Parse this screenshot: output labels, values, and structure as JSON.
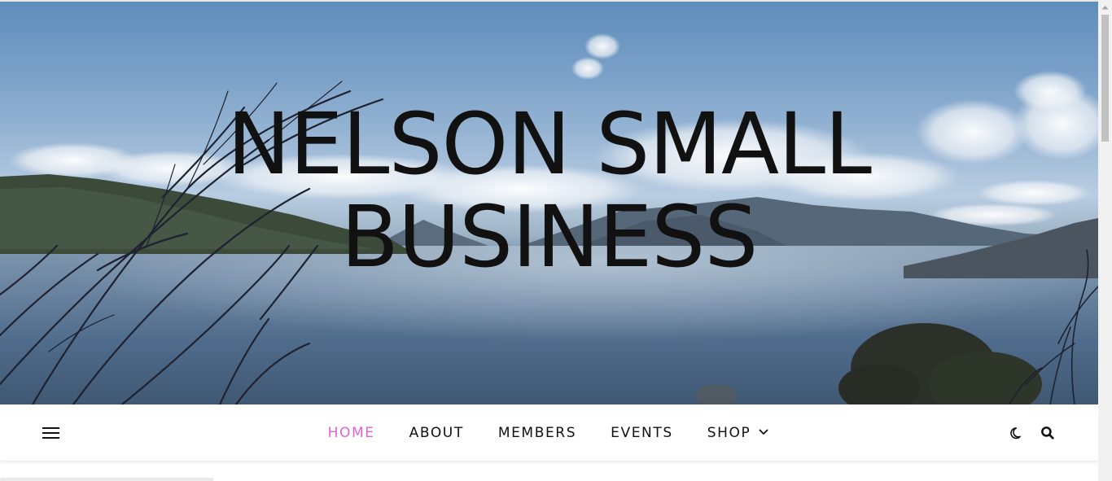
{
  "site": {
    "title_line1": "NELSON SMALL",
    "title_line2": "BUSINESS"
  },
  "nav": {
    "items": [
      {
        "label": "HOME",
        "active": true
      },
      {
        "label": "ABOUT",
        "active": false
      },
      {
        "label": "MEMBERS",
        "active": false
      },
      {
        "label": "EVENTS",
        "active": false
      },
      {
        "label": "SHOP",
        "active": false,
        "has_dropdown": true
      }
    ],
    "icons": {
      "menu": "hamburger-menu-icon",
      "theme": "moon-icon",
      "search": "search-icon",
      "dropdown": "chevron-down-icon"
    }
  },
  "colors": {
    "accent": "#e062d9",
    "text": "#111111",
    "nav_background": "#ffffff"
  },
  "scrollbar": {
    "position_fraction": 0.0
  }
}
